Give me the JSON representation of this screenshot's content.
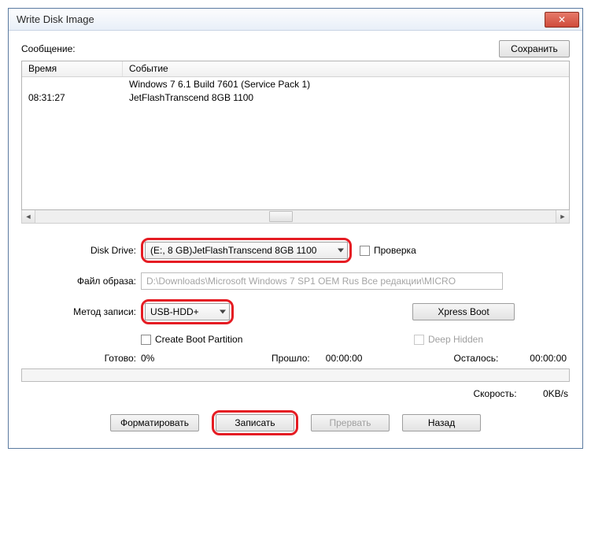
{
  "window": {
    "title": "Write Disk Image"
  },
  "message": {
    "label": "Сообщение:",
    "saveBtn": "Сохранить"
  },
  "log": {
    "colTime": "Время",
    "colEvent": "Событие",
    "rows": [
      {
        "time": "",
        "event": "Windows 7 6.1 Build 7601 (Service Pack 1)"
      },
      {
        "time": "08:31:27",
        "event": "JetFlashTranscend 8GB  1100"
      }
    ]
  },
  "diskDrive": {
    "label": "Disk Drive:",
    "value": "(E:, 8 GB)JetFlashTranscend 8GB  1100",
    "verify": "Проверка"
  },
  "imageFile": {
    "label": "Файл образа:",
    "value": "D:\\Downloads\\Microsoft Windows 7 SP1 OEM Rus Все редакции\\MICRO"
  },
  "writeMethod": {
    "label": "Метод записи:",
    "value": "USB-HDD+",
    "xpress": "Xpress Boot"
  },
  "options": {
    "createBoot": "Create Boot Partition",
    "deepHidden": "Deep Hidden"
  },
  "status": {
    "readyLabel": "Готово:",
    "readyValue": "0%",
    "elapsedLabel": "Прошло:",
    "elapsedValue": "00:00:00",
    "remainLabel": "Осталось:",
    "remainValue": "00:00:00"
  },
  "speed": {
    "label": "Скорость:",
    "value": "0KB/s"
  },
  "buttons": {
    "format": "Форматировать",
    "write": "Записать",
    "abort": "Прервать",
    "back": "Назад"
  }
}
